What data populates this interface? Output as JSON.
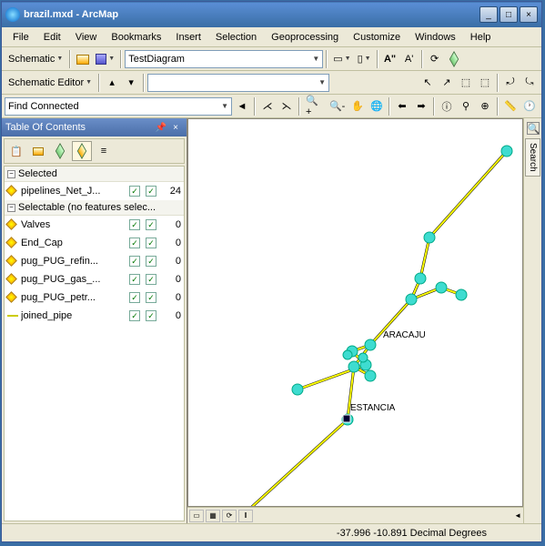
{
  "title": "brazil.mxd - ArcMap",
  "menu": [
    "File",
    "Edit",
    "View",
    "Bookmarks",
    "Insert",
    "Selection",
    "Geoprocessing",
    "Customize",
    "Windows",
    "Help"
  ],
  "tb1": {
    "schematic": "Schematic",
    "diagram": "TestDiagram"
  },
  "tb2": {
    "editor": "Schematic Editor",
    "trace": "Find Connected"
  },
  "toc": {
    "title": "Table Of Contents",
    "groups": [
      {
        "title": "Selected",
        "rows": [
          {
            "sym": "pt",
            "label": "pipelines_Net_J...",
            "c1": true,
            "c2": true,
            "count": "24"
          }
        ]
      },
      {
        "title": "Selectable (no features selec...",
        "rows": [
          {
            "sym": "pt",
            "label": "Valves",
            "c1": true,
            "c2": true,
            "count": "0"
          },
          {
            "sym": "pt",
            "label": "End_Cap",
            "c1": true,
            "c2": true,
            "count": "0"
          },
          {
            "sym": "pt",
            "label": "pug_PUG_refin...",
            "c1": true,
            "c2": true,
            "count": "0"
          },
          {
            "sym": "pt",
            "label": "pug_PUG_gas_...",
            "c1": true,
            "c2": true,
            "count": "0"
          },
          {
            "sym": "pt",
            "label": "pug_PUG_petr...",
            "c1": true,
            "c2": true,
            "count": "0"
          },
          {
            "sym": "ln",
            "label": "joined_pipe",
            "c1": true,
            "c2": true,
            "count": "0"
          }
        ]
      }
    ]
  },
  "labels": {
    "est": "ESTANCIA",
    "ara": "ARACAJU"
  },
  "status": {
    "coords": "-37.996   -10.891 Decimal Degrees"
  },
  "right": {
    "search": "Search"
  }
}
